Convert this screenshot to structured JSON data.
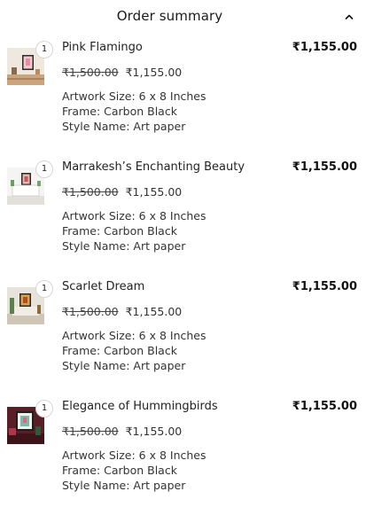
{
  "header": {
    "title": "Order summary",
    "toggle_icon": "chevron-up-icon"
  },
  "items": [
    {
      "name": "Pink Flamingo",
      "quantity": "1",
      "line_total": "₹1,155.00",
      "original_price": "₹1,500.00",
      "sale_price": "₹1,155.00",
      "attributes": [
        "Artwork Size: 6 x 8 Inches",
        "Frame: Carbon Black",
        "Style Name: Art paper"
      ]
    },
    {
      "name": "Marrakesh’s Enchanting Beauty",
      "quantity": "1",
      "line_total": "₹1,155.00",
      "original_price": "₹1,500.00",
      "sale_price": "₹1,155.00",
      "attributes": [
        "Artwork Size: 6 x 8 Inches",
        "Frame: Carbon Black",
        "Style Name: Art paper"
      ]
    },
    {
      "name": "Scarlet Dream",
      "quantity": "1",
      "line_total": "₹1,155.00",
      "original_price": "₹1,500.00",
      "sale_price": "₹1,155.00",
      "attributes": [
        "Artwork Size: 6 x 8 Inches",
        "Frame: Carbon Black",
        "Style Name: Art paper"
      ]
    },
    {
      "name": "Elegance of Hummingbirds",
      "quantity": "1",
      "line_total": "₹1,155.00",
      "original_price": "₹1,500.00",
      "sale_price": "₹1,155.00",
      "attributes": [
        "Artwork Size: 6 x 8 Inches",
        "Frame: Carbon Black",
        "Style Name: Art paper"
      ]
    }
  ]
}
